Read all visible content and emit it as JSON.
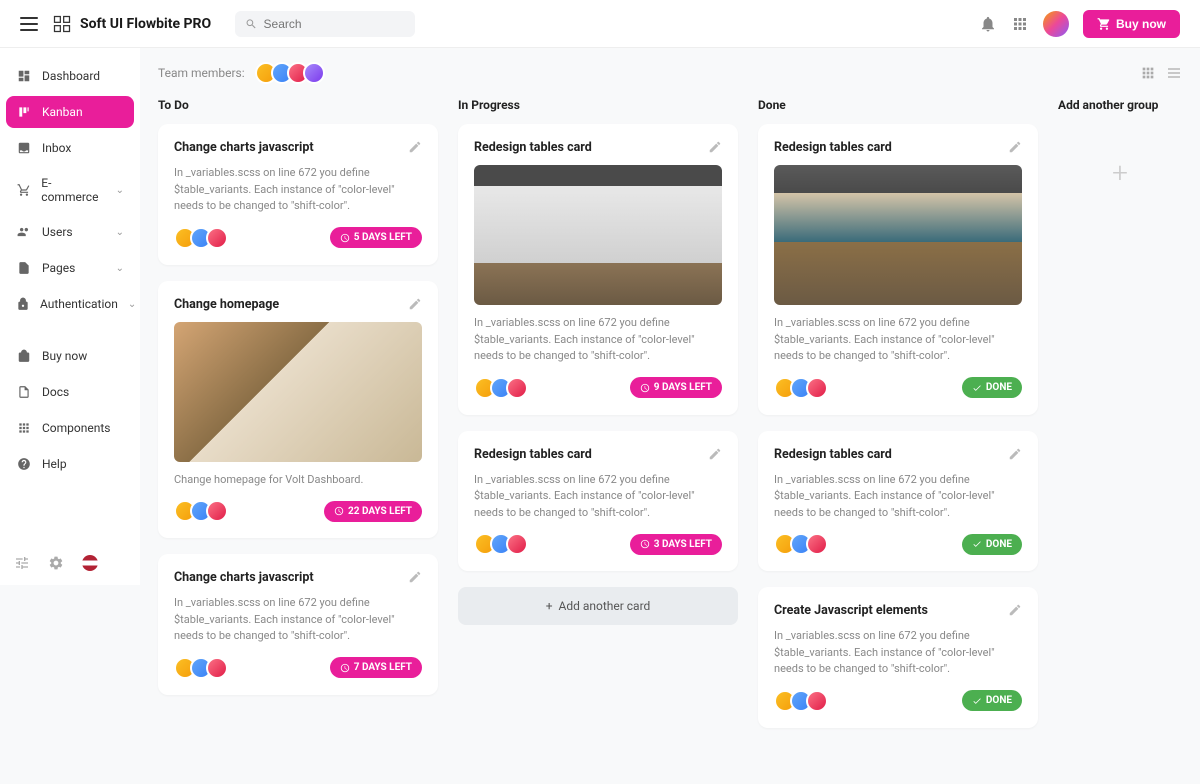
{
  "brand": "Soft UI Flowbite PRO",
  "search": {
    "placeholder": "Search"
  },
  "buy_now": "Buy now",
  "team_label": "Team members:",
  "sidebar": {
    "items": [
      {
        "label": "Dashboard",
        "icon": "dashboard-icon",
        "expandable": false
      },
      {
        "label": "Kanban",
        "icon": "kanban-icon",
        "expandable": false,
        "active": true
      },
      {
        "label": "Inbox",
        "icon": "inbox-icon",
        "expandable": false
      },
      {
        "label": "E-commerce",
        "icon": "cart-icon",
        "expandable": true
      },
      {
        "label": "Users",
        "icon": "users-icon",
        "expandable": true
      },
      {
        "label": "Pages",
        "icon": "pages-icon",
        "expandable": true
      },
      {
        "label": "Authentication",
        "icon": "lock-icon",
        "expandable": true
      }
    ],
    "secondary": [
      {
        "label": "Buy now",
        "icon": "bag-icon"
      },
      {
        "label": "Docs",
        "icon": "docs-icon"
      },
      {
        "label": "Components",
        "icon": "components-icon"
      },
      {
        "label": "Help",
        "icon": "help-icon"
      }
    ]
  },
  "columns": [
    {
      "title": "To Do",
      "cards": [
        {
          "title": "Change charts javascript",
          "desc": "In _variables.scss on line 672 you define $table_variants. Each instance of \"color-level\" needs to be changed to \"shift-color\".",
          "badge": "5 DAYS LEFT",
          "badge_type": "pink",
          "has_image": false
        },
        {
          "title": "Change homepage",
          "desc": "Change homepage for Volt Dashboard.",
          "badge": "22 DAYS LEFT",
          "badge_type": "pink",
          "has_image": true,
          "image_class": "img-meeting"
        },
        {
          "title": "Change charts javascript",
          "desc": "In _variables.scss on line 672 you define $table_variants. Each instance of \"color-level\" needs to be changed to \"shift-color\".",
          "badge": "7 DAYS LEFT",
          "badge_type": "pink",
          "has_image": false
        }
      ]
    },
    {
      "title": "In Progress",
      "cards": [
        {
          "title": "Redesign tables card",
          "desc": "In _variables.scss on line 672 you define $table_variants. Each instance of \"color-level\" needs to be changed to \"shift-color\".",
          "badge": "9 DAYS LEFT",
          "badge_type": "pink",
          "has_image": true,
          "image_class": "img-whiteboard"
        },
        {
          "title": "Redesign tables card",
          "desc": "In _variables.scss on line 672 you define $table_variants. Each instance of \"color-level\" needs to be changed to \"shift-color\".",
          "badge": "3 DAYS LEFT",
          "badge_type": "pink",
          "has_image": false
        }
      ],
      "add_card": "Add another card"
    },
    {
      "title": "Done",
      "cards": [
        {
          "title": "Redesign tables card",
          "desc": "In _variables.scss on line 672 you define $table_variants. Each instance of \"color-level\" needs to be changed to \"shift-color\".",
          "badge": "DONE",
          "badge_type": "green",
          "has_image": true,
          "image_class": "img-team"
        },
        {
          "title": "Redesign tables card",
          "desc": "In _variables.scss on line 672 you define $table_variants. Each instance of \"color-level\" needs to be changed to \"shift-color\".",
          "badge": "DONE",
          "badge_type": "green",
          "has_image": false
        },
        {
          "title": "Create Javascript elements",
          "desc": "In _variables.scss on line 672 you define $table_variants. Each instance of \"color-level\" needs to be changed to \"shift-color\".",
          "badge": "DONE",
          "badge_type": "green",
          "has_image": false
        }
      ]
    }
  ],
  "add_group": "Add another group"
}
